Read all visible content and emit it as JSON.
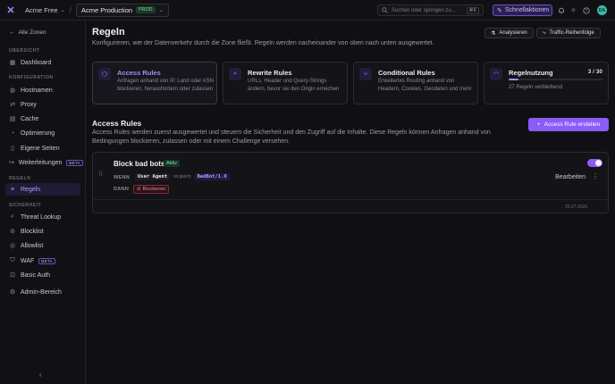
{
  "topbar": {
    "org_name": "Acme Free",
    "zone_name": "Acme Production",
    "zone_badge": "PROD",
    "search_placeholder": "Suchen oder springen zu...",
    "search_shortcut": "⌘K",
    "quick_actions": "Schnellaktionen",
    "avatar_initials": "DA"
  },
  "sidebar": {
    "back_label": "Alle Zonen",
    "sections": {
      "overview": "ÜBERSICHT",
      "config": "KONFIGURATION",
      "rules": "REGELN",
      "security": "SICHERHEIT"
    },
    "items": {
      "dashboard": "Dashboard",
      "hostnames": "Hostnamen",
      "proxy": "Proxy",
      "cache": "Cache",
      "optimization": "Optimierung",
      "custom_pages": "Eigene Seiten",
      "redirects": "Weiterleitungen",
      "redirects_badge": "BETA",
      "rules": "Regeln",
      "threat_lookup": "Threat Lookup",
      "blocklist": "Blocklist",
      "allowlist": "Allowlist",
      "waf": "WAF",
      "waf_badge": "BETA",
      "basic_auth": "Basic Auth",
      "admin": "Admin-Bereich"
    }
  },
  "header": {
    "title": "Regeln",
    "subtitle": "Konfigurieren, wie der Datenverkehr durch die Zone fließt. Regeln werden nacheinander von oben nach unten ausgewertet.",
    "analyze_label": "Analysieren",
    "traffic_order_label": "Traffic-Reihenfolge"
  },
  "cards": [
    {
      "title": "Access Rules",
      "desc": "Anfragen anhand von IP, Land oder ASN blockieren, herausfordern oder zulassen",
      "icon": "shield-icon"
    },
    {
      "title": "Rewrite Rules",
      "desc": "URLs, Header und Query-Strings ändern, bevor sie den Origin erreichen",
      "icon": "rewrite-icon"
    },
    {
      "title": "Conditional Rules",
      "desc": "Erweitertes Routing anhand von Headern, Cookies, Geodaten und mehr",
      "icon": "branch-icon"
    }
  ],
  "usage": {
    "title": "Regelnutzung",
    "count": "3 / 30",
    "fraction": 0.1,
    "remaining": "27 Regeln verbleibend"
  },
  "access_rules": {
    "title": "Access Rules",
    "description": "Access Rules werden zuerst ausgewertet und steuern die Sicherheit und den Zugriff auf die Inhalte. Diese Regeln können Anfragen anhand von Bedingungen blockieren, zulassen oder mit einem Challenge versehen.",
    "create_label": "Access Rule erstellen"
  },
  "rule": {
    "name": "Block bad bots",
    "status": "Aktiv",
    "when_label": "WENN",
    "field": "User Agent",
    "operator": "ist gleich",
    "value": "BadBot/1.0",
    "then_label": "DANN",
    "action": "Blockieren",
    "edit_label": "Bearbeiten",
    "date": "20.07.2026"
  },
  "colors": {
    "accent": "#8b5cf6",
    "accent_text": "#b59cff",
    "success": "#7ee2a8",
    "danger": "#ff7b8e"
  }
}
